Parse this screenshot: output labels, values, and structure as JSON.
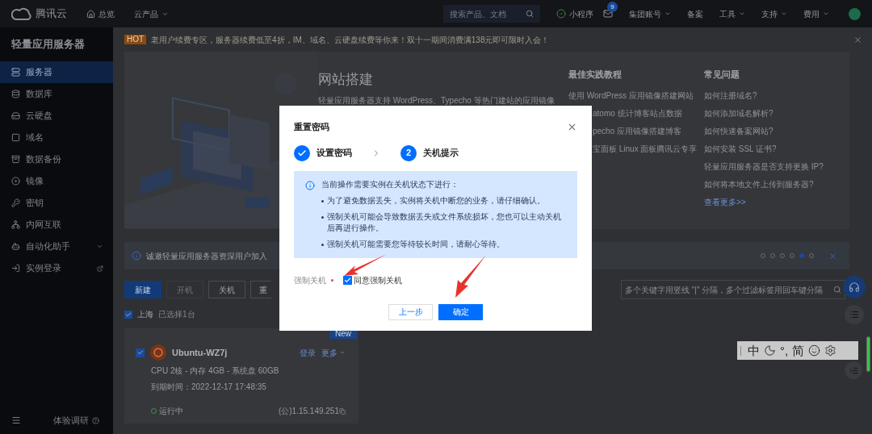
{
  "topbar": {
    "brand": "腾讯云",
    "nav": [
      {
        "label": "总览",
        "dropdown": false
      },
      {
        "label": "云产品",
        "dropdown": true
      }
    ],
    "search": {
      "placeholder": "搜索产品、文档"
    },
    "items": [
      {
        "kind": "miniapp",
        "label": "小程序"
      },
      {
        "kind": "mail",
        "badge": "9"
      },
      {
        "kind": "link",
        "label": "集团账号",
        "dropdown": true
      },
      {
        "kind": "link",
        "label": "备案",
        "dropdown": false
      },
      {
        "kind": "link",
        "label": "工具",
        "dropdown": true
      },
      {
        "kind": "link",
        "label": "支持",
        "dropdown": true
      },
      {
        "kind": "link",
        "label": "费用",
        "dropdown": true
      },
      {
        "kind": "avatar"
      }
    ]
  },
  "sidebar": {
    "title": "轻量应用服务器",
    "items": [
      {
        "label": "服务器",
        "selected": true,
        "kind": "page"
      },
      {
        "label": "数据库",
        "selected": false,
        "kind": "page"
      },
      {
        "label": "云硬盘",
        "selected": false,
        "kind": "page"
      },
      {
        "label": "域名",
        "selected": false,
        "kind": "page"
      },
      {
        "label": "数据备份",
        "selected": false,
        "kind": "page"
      },
      {
        "label": "镜像",
        "selected": false,
        "kind": "page"
      },
      {
        "label": "密钥",
        "selected": false,
        "kind": "page"
      },
      {
        "label": "内网互联",
        "selected": false,
        "kind": "page"
      },
      {
        "label": "自动化助手",
        "selected": false,
        "kind": "group"
      },
      {
        "label": "实例登录",
        "selected": false,
        "kind": "external"
      }
    ],
    "footer": "体验调研"
  },
  "promo": {
    "badge": "HOT",
    "text": "老用户续费专区，服务器续费低至4折，IM、域名、云硬盘续费等你来！双十一期间消费满138元即可限时入会！"
  },
  "guide": {
    "title": "网站搭建",
    "description": "轻量应用服务器支持 WordPress、Typecho 等热门建站的应用镜像",
    "tutorials": {
      "title": "最佳实践教程",
      "items": [
        "使用 WordPress 应用镜像搭建网站",
        "atomo 统计博客站点数据",
        "pecho 应用镜像搭建博客",
        "宝面板 Linux 面板腾讯云专享"
      ]
    },
    "faq": {
      "title": "常见问题",
      "items": [
        "如何注册域名?",
        "如何添加域名解析?",
        "如何快速备案网站?",
        "如何安装 SSL 证书?",
        "轻量应用服务器是否支持更换 IP?",
        "如何将本地文件上传到服务器?"
      ],
      "more": "查看更多>>"
    }
  },
  "notice": {
    "text": "诚邀轻量应用服务器资深用户加入",
    "dots": [
      {
        "selected": false
      },
      {
        "selected": false
      },
      {
        "selected": false
      },
      {
        "selected": false
      },
      {
        "selected": true
      },
      {
        "selected": false
      }
    ]
  },
  "toolbar": {
    "buttons": [
      {
        "label": "新建",
        "kind": "primary",
        "disabled": false
      },
      {
        "label": "开机",
        "kind": "default",
        "disabled": true
      },
      {
        "label": "关机",
        "kind": "default",
        "disabled": false
      },
      {
        "label": "重",
        "kind": "default",
        "disabled": false
      }
    ],
    "search": {
      "placeholder": "多个关键字用竖线 \"|\" 分隔，多个过滤标签用回车键分隔"
    }
  },
  "region": {
    "label": "上海",
    "checked": true,
    "count": "已选择1台"
  },
  "instance": {
    "name": "Ubuntu-WZ7j",
    "badge": "New",
    "checked": true,
    "actions": [
      "登录",
      "更多"
    ],
    "specs": "CPU 2核 - 内存 4GB - 系统盘 60GB",
    "expiry": "到期时间：2022-12-17 17:48:35",
    "status": "运行中",
    "ip": "(公)1.15.149.251"
  },
  "ime": {
    "items": [
      {
        "kind": "text",
        "label": "中"
      },
      {
        "kind": "moon"
      },
      {
        "kind": "text",
        "label": "°,"
      },
      {
        "kind": "text",
        "label": "简"
      },
      {
        "kind": "smile"
      },
      {
        "kind": "gear"
      }
    ]
  },
  "modal": {
    "title": "重置密码",
    "steps": [
      {
        "label": "设置密码",
        "completed": true
      },
      {
        "number": "2",
        "label": "关机提示",
        "completed": false
      }
    ],
    "alert": {
      "heading": "当前操作需要实例在关机状态下进行：",
      "bullets": [
        "为了避免数据丢失，实例将关机中断您的业务，请仔细确认。",
        "强制关机可能会导致数据丢失或文件系统损坏，您也可以主动关机后再进行操作。",
        "强制关机可能需要您等待较长时间，请耐心等待。"
      ]
    },
    "field": {
      "label": "强制关机",
      "required": true,
      "option": "同意强制关机",
      "checked": true
    },
    "buttons": [
      {
        "label": "上一步",
        "kind": "default"
      },
      {
        "label": "确定",
        "kind": "primary"
      }
    ]
  }
}
